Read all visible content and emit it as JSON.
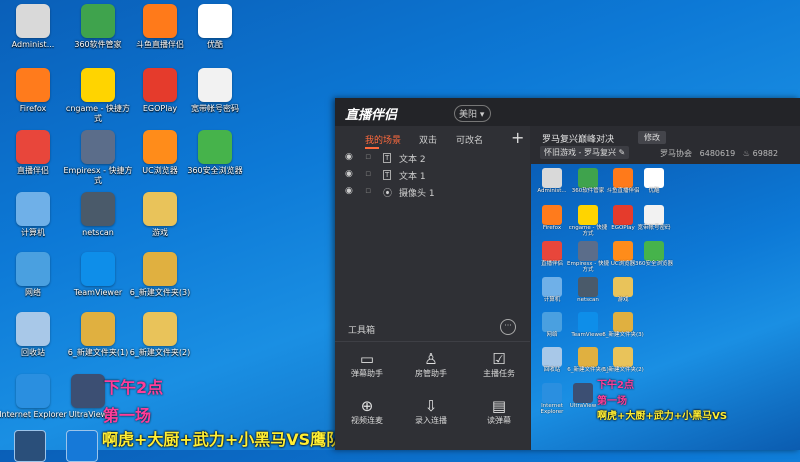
{
  "desktop": {
    "icons": [
      {
        "label": "Administ...",
        "icon": "admin-user-icon",
        "color": "#d9d9d9"
      },
      {
        "label": "360软件管家",
        "icon": "360-software-icon",
        "color": "#3fa34d"
      },
      {
        "label": "斗鱼直播伴侣",
        "icon": "douyu-icon",
        "color": "#ff7a1a"
      },
      {
        "label": "优酷",
        "icon": "youku-icon",
        "color": "#ffffff"
      },
      {
        "label": "Firefox",
        "icon": "firefox-icon",
        "color": "#ff7b1c"
      },
      {
        "label": "cngame - 快捷方式",
        "icon": "pacman-icon",
        "color": "#ffd400"
      },
      {
        "label": "EGOPlay",
        "icon": "egoplay-icon",
        "color": "#e53b2c"
      },
      {
        "label": "宽带帐号密码",
        "icon": "text-file-icon",
        "color": "#f2f2f2"
      },
      {
        "label": "直播伴侣",
        "icon": "live-companion-icon",
        "color": "#e8463b"
      },
      {
        "label": "Empiresx - 快捷方式",
        "icon": "empires-icon",
        "color": "#5b6d8a"
      },
      {
        "label": "UC浏览器",
        "icon": "uc-browser-icon",
        "color": "#ff8c1a"
      },
      {
        "label": "360安全浏览器",
        "icon": "360-browser-icon",
        "color": "#46b34b"
      },
      {
        "label": "计算机",
        "icon": "computer-icon",
        "color": "#6fb0e8"
      },
      {
        "label": "netscan",
        "icon": "netscan-icon",
        "color": "#4a5a6a"
      },
      {
        "label": "游戏",
        "icon": "folder-icon",
        "color": "#e9c35a"
      },
      {
        "label": "网络",
        "icon": "network-icon",
        "color": "#4aa0e0"
      },
      {
        "label": "TeamViewer",
        "icon": "teamviewer-icon",
        "color": "#0e8ee9"
      },
      {
        "label": "6_新建文件夹(3)",
        "icon": "zip-folder-icon",
        "color": "#e0b040"
      },
      {
        "label": "回收站",
        "icon": "recycle-bin-icon",
        "color": "#a8c8e8"
      },
      {
        "label": "6_新建文件夹(1)",
        "icon": "zip-folder-icon",
        "color": "#e0b040"
      },
      {
        "label": "6_新建文件夹(2)",
        "icon": "folder-icon",
        "color": "#e9c35a"
      },
      {
        "label": "Internet Explorer",
        "icon": "ie-icon",
        "color": "#2a8fe0"
      },
      {
        "label": "UltraView",
        "icon": "ultraview-icon",
        "color": "#3c4f73"
      }
    ]
  },
  "app": {
    "brand": "直播伴侣",
    "version_badge": "美阳",
    "tabs": [
      "我的场景",
      "双击",
      "可改名"
    ],
    "add_symbol": "+",
    "sources": [
      {
        "name": "文本 2"
      },
      {
        "name": "文本 1"
      },
      {
        "name": "摄像头 1"
      }
    ],
    "tools_title": "工具箱",
    "tools_more": "···",
    "tools": [
      {
        "label": "弹幕助手",
        "icon": "danmaku-helper-icon"
      },
      {
        "label": "房管助手",
        "icon": "room-manager-icon"
      },
      {
        "label": "主播任务",
        "icon": "anchor-task-icon"
      },
      {
        "label": "视频连麦",
        "icon": "video-link-icon"
      },
      {
        "label": "录入连播",
        "icon": "record-icon"
      },
      {
        "label": "读弹幕",
        "icon": "read-danmaku-icon"
      }
    ],
    "room": {
      "title": "罗马复兴巅峰对决",
      "edit_label": "修改",
      "category": "怀旧游戏 - 罗马复兴",
      "owner": "罗马协会",
      "room_id": "6480619",
      "popularity": "69882"
    }
  },
  "overlay": {
    "time": "下午2点",
    "match": "第一场",
    "lineup": "啊虎+大厨+武力+小黑马VS鹰队+火海+过瘾+着草人",
    "preview_lineup": "啊虎+大厨+武力+小黑马VS"
  }
}
